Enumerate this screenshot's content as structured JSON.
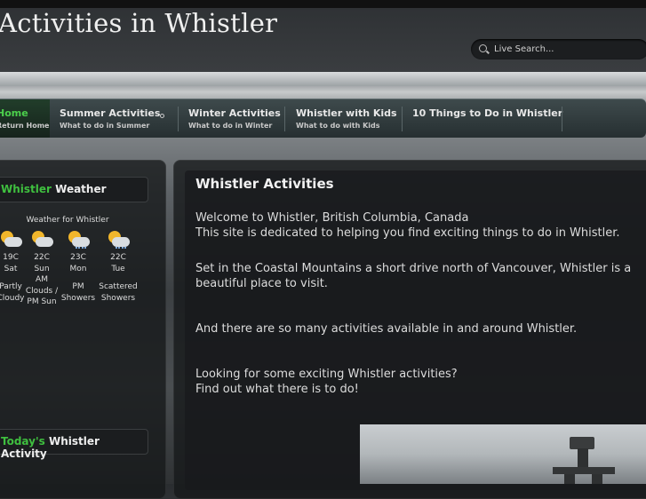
{
  "site": {
    "title": "Activities in Whistler"
  },
  "search": {
    "placeholder": "Live Search..."
  },
  "nav": {
    "items": [
      {
        "label": "Home",
        "sub": "Return Home"
      },
      {
        "label": "Summer Activities",
        "sub": "What to do in Summer"
      },
      {
        "label": "Winter Activities",
        "sub": "What to do in Winter"
      },
      {
        "label": "Whistler with Kids",
        "sub": "What to do with Kids"
      },
      {
        "label": "10 Things to Do in Whistler",
        "sub": ""
      }
    ]
  },
  "sidebar": {
    "weather_heading_accent": "Whistler",
    "weather_heading": "Weather",
    "weather_title": "Weather for Whistler",
    "days": [
      {
        "temp": "19C",
        "day": "Sat",
        "cond": "Partly Cloudy",
        "icon": "partly-cloudy-icon"
      },
      {
        "temp": "22C",
        "day": "Sun",
        "cond": "AM Clouds / PM Sun",
        "icon": "partly-cloudy-icon"
      },
      {
        "temp": "23C",
        "day": "Mon",
        "cond": "PM Showers",
        "icon": "showers-icon"
      },
      {
        "temp": "22C",
        "day": "Tue",
        "cond": "Scattered Showers",
        "icon": "showers-icon"
      }
    ],
    "activity_heading_accent": "Today's",
    "activity_heading": "Whistler Activity"
  },
  "main": {
    "title": "Whistler Activities",
    "p1_line1": "Welcome to Whistler, British Columbia, Canada",
    "p1_line2": "This site is dedicated to helping you find exciting things to do in Whistler.",
    "p2": "Set in the Coastal Mountains a short drive north of Vancouver, Whistler is a beautiful place to visit.",
    "p3": "And there are so many activities available in and around Whistler.",
    "p4_line1": "Looking for some exciting Whistler activities?",
    "p4_line2": "Find out what there is to do!"
  },
  "colors": {
    "accent": "#3fbf3f",
    "nav_active": "#4ccf4c"
  }
}
